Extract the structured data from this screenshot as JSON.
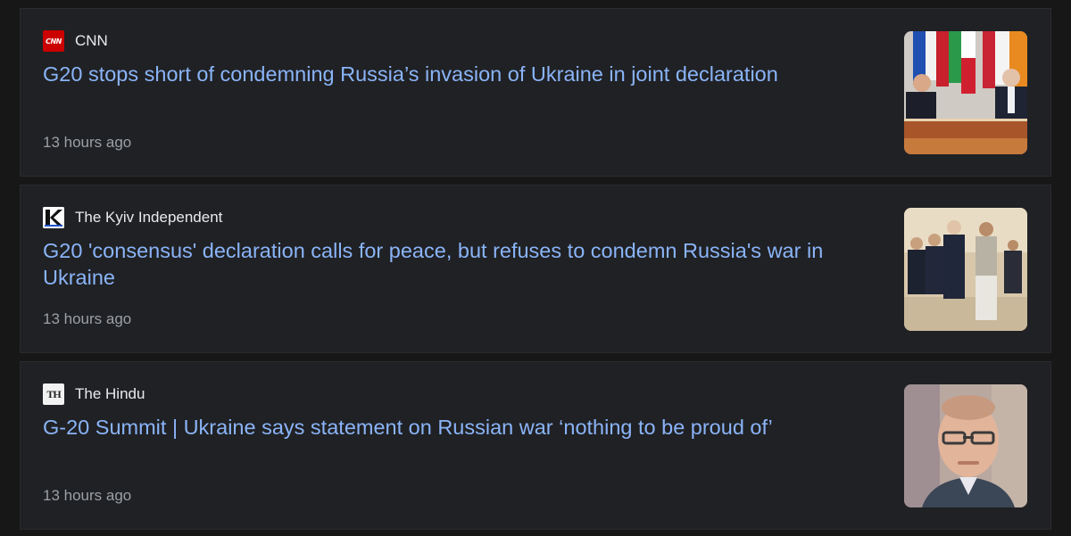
{
  "articles": [
    {
      "source": "CNN",
      "logo_text": "CNN",
      "logo_icon": "cnn-logo-icon",
      "headline": "G20 stops short of condemning Russia’s invasion of Ukraine in joint declaration",
      "time": "13 hours ago"
    },
    {
      "source": "The Kyiv Independent",
      "logo_icon": "kyiv-independent-logo-icon",
      "headline": "G20 'consensus' declaration calls for peace, but refuses to condemn Russia's war in Ukraine",
      "time": "13 hours ago"
    },
    {
      "source": "The Hindu",
      "logo_text": "TH",
      "logo_icon": "the-hindu-logo-icon",
      "headline": "G-20 Summit | Ukraine says statement on Russian war ‘nothing to be proud of’",
      "time": "13 hours ago"
    }
  ],
  "colors": {
    "background": "#171717",
    "card": "#202124",
    "headline": "#8ab4f8",
    "source": "#e8eaed",
    "time": "#9aa0a6"
  }
}
